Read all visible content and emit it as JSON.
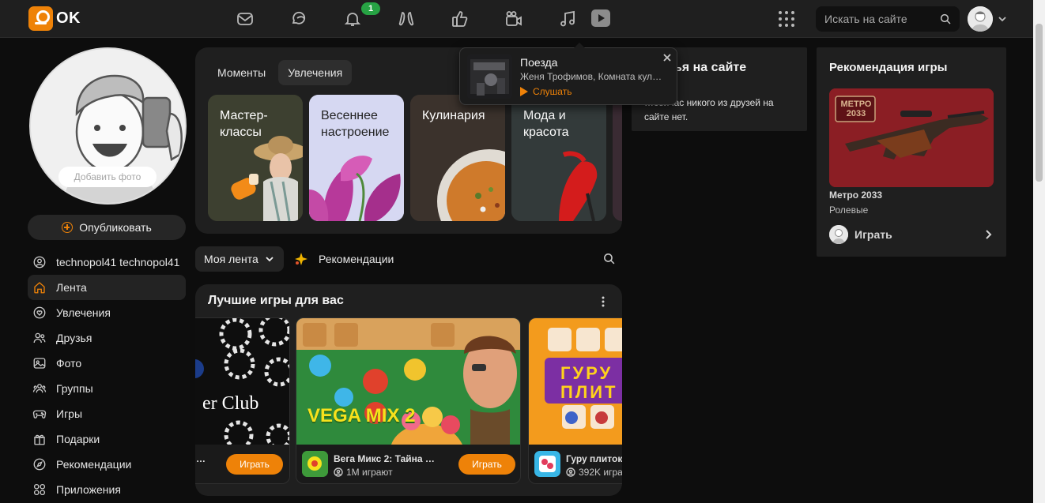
{
  "header": {
    "logo_text": "OK",
    "notification_count": "1",
    "search_placeholder": "Искать на сайте",
    "accent_color": "#ee8208",
    "badge_color": "#27a344"
  },
  "sidebar": {
    "add_photo_label": "Добавить фото",
    "publish_label": "Опубликовать",
    "items": [
      {
        "label": "technopol41 technopol41",
        "icon": "profile-icon"
      },
      {
        "label": "Лента",
        "icon": "home-icon"
      },
      {
        "label": "Увлечения",
        "icon": "heart-icon"
      },
      {
        "label": "Друзья",
        "icon": "friends-icon"
      },
      {
        "label": "Фото",
        "icon": "photo-icon"
      },
      {
        "label": "Группы",
        "icon": "groups-icon"
      },
      {
        "label": "Игры",
        "icon": "gamepad-icon"
      },
      {
        "label": "Подарки",
        "icon": "gift-icon"
      },
      {
        "label": "Рекомендации",
        "icon": "compass-icon"
      },
      {
        "label": "Приложения",
        "icon": "apps-icon"
      }
    ]
  },
  "interests": {
    "tabs": [
      "Моменты",
      "Увлечения"
    ],
    "cards": [
      {
        "label": "Мастер-\nклассы"
      },
      {
        "label": "Весеннее\nнастроение"
      },
      {
        "label": "Кулинария"
      },
      {
        "label": "Мода и\nкрасота"
      }
    ]
  },
  "feed": {
    "select_label": "Моя лента",
    "recommendations_label": "Рекомендации"
  },
  "games": {
    "title": "Лучшие игры для вас",
    "items": [
      {
        "name": "…",
        "players": "",
        "play": "Играть",
        "art_text": "er Club"
      },
      {
        "name": "Вега Микс 2: Тайна …",
        "players": "1M играют",
        "play": "Играть",
        "art_text": "VEGA MIX 2"
      },
      {
        "name": "Гуру плиток",
        "players": "392K игра",
        "play": "Играть",
        "art_text": "ГУРУ ПЛИТ"
      }
    ]
  },
  "friends_online": {
    "title": "…зья на сайте",
    "text": "…сейчас никого из друзей на сайте нет."
  },
  "game_recommendation": {
    "title": "Рекомендация игры",
    "art_text": "МЕТРО 2033",
    "name": "Метро 2033",
    "genre": "Ролевые",
    "play": "Играть"
  },
  "music_popup": {
    "title": "Поезда",
    "artist": "Женя Трофимов, Комната культуры",
    "listen": "Слушать"
  }
}
